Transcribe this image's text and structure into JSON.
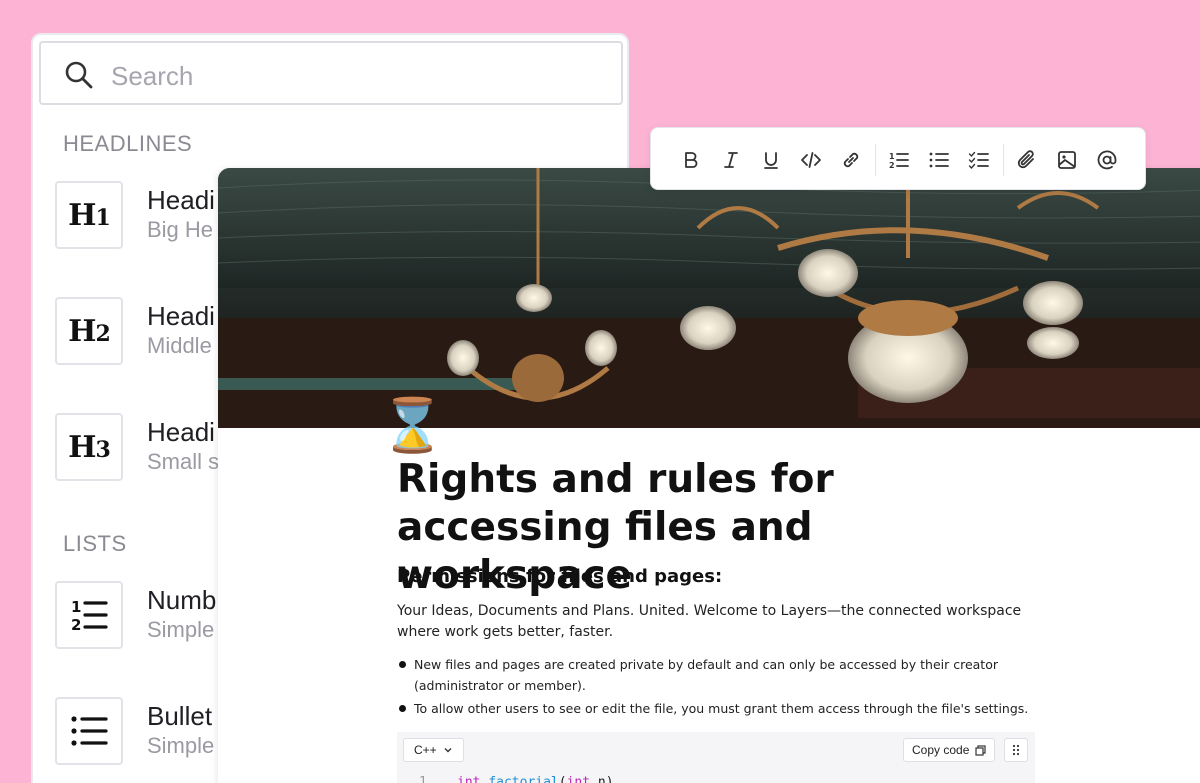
{
  "palette": {
    "search_placeholder": "Search",
    "sections": [
      {
        "label": "HEADLINES",
        "items": [
          {
            "title": "Headi",
            "subtitle": "Big He",
            "icon": "heading-1-icon",
            "glyph": "H",
            "glyph_sub": "1"
          },
          {
            "title": "Headi",
            "subtitle": "Middle",
            "icon": "heading-2-icon",
            "glyph": "H",
            "glyph_sub": "2"
          },
          {
            "title": "Headi",
            "subtitle": "Small s",
            "icon": "heading-3-icon",
            "glyph": "H",
            "glyph_sub": "3"
          }
        ]
      },
      {
        "label": "LISTS",
        "items": [
          {
            "title": "Numb",
            "subtitle": "Simple",
            "icon": "numbered-list-icon"
          },
          {
            "title": "Bullet",
            "subtitle": "Simple",
            "icon": "bullet-list-icon"
          }
        ]
      }
    ]
  },
  "toolbar": {
    "buttons": [
      "bold-icon",
      "italic-icon",
      "underline-icon",
      "code-icon",
      "link-icon",
      "ordered-list-icon",
      "bullet-list-icon",
      "checklist-icon",
      "attachment-icon",
      "image-icon",
      "mention-icon"
    ]
  },
  "document": {
    "emoji": "⌛",
    "title": "Rights and rules for accessing files and workspace",
    "subtitle": "Permissions for files and pages:",
    "paragraph": "Your Ideas, Documents and Plans. United. Welcome to Layers—the connected workspace where work gets better, faster.",
    "bullets": [
      "New files and pages are created private by default and can only be accessed by their creator (administrator or member).",
      "To allow other users to see or edit the file, you must grant them access through the file's settings."
    ],
    "code_block": {
      "language": "C++",
      "copy_label": "Copy code",
      "line_number": "1",
      "kw1": "int",
      "fn": "factorial",
      "open": "(",
      "kw2": "int",
      "arg": " n)"
    }
  }
}
